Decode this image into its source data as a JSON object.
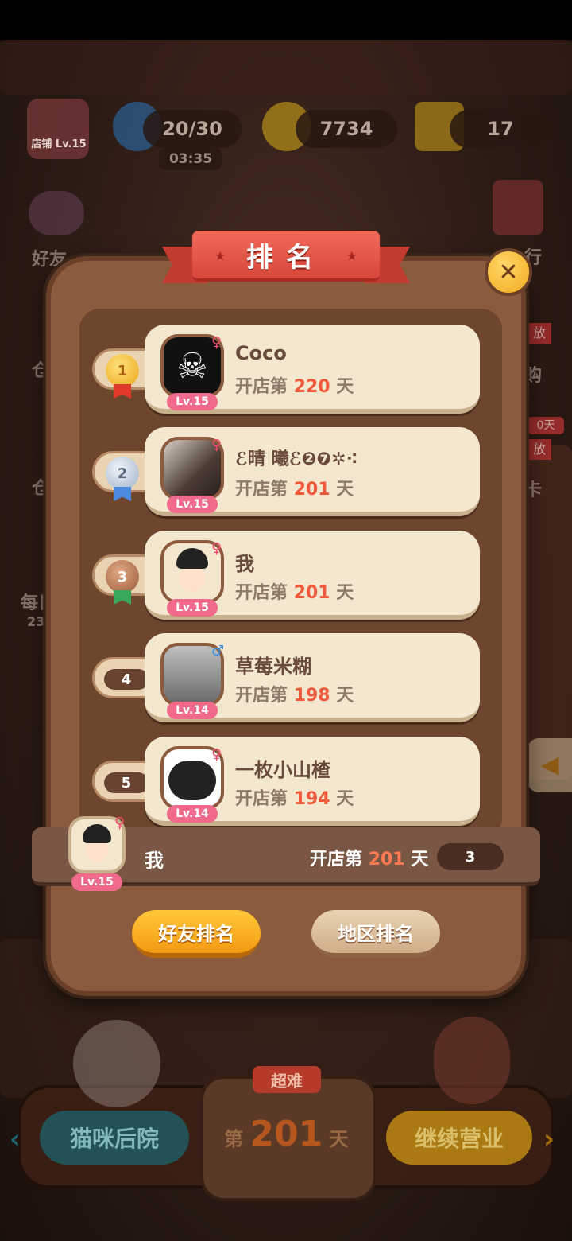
{
  "top": {
    "shop_level": "店铺 Lv.15",
    "energy": "20/30",
    "energy_timer": "03:35",
    "coins": "7734",
    "stars": "17"
  },
  "side": {
    "friends": "好友",
    "left_2": "仓",
    "left_3": "仓",
    "left_4": "每日",
    "left_4_sub": "23",
    "right_1": "行",
    "right_2": "购",
    "right_2_badge": "放",
    "right_3": "卡",
    "right_3_badge": "放",
    "right_3_tag": "0天"
  },
  "modal": {
    "title": "排名",
    "close": "✕",
    "days_prefix": "开店第",
    "days_suffix": "天",
    "players": [
      {
        "rank": "1",
        "name": "Coco",
        "days": "220",
        "level": "Lv.15",
        "gender": "♀"
      },
      {
        "rank": "2",
        "name": "ℰ晴 曦ℰ❷❼✲⁖",
        "days": "201",
        "level": "Lv.15",
        "gender": "♀"
      },
      {
        "rank": "3",
        "name": "我",
        "days": "201",
        "level": "Lv.15",
        "gender": "♀"
      },
      {
        "rank": "4",
        "name": "草莓米糊",
        "days": "198",
        "level": "Lv.14",
        "gender": "♂"
      },
      {
        "rank": "5",
        "name": "一枚小山楂",
        "days": "194",
        "level": "Lv.14",
        "gender": "♀"
      }
    ],
    "me": {
      "name": "我",
      "days": "201",
      "level": "Lv.15",
      "rank": "3",
      "gender": "♀"
    },
    "tabs": {
      "friend": "好友排名",
      "region": "地区排名"
    }
  },
  "bottom": {
    "cat_backyard": "猫咪后院",
    "difficulty": "超难",
    "day_prefix": "第",
    "day_num": "201",
    "day_suffix": "天",
    "continue": "继续营业"
  }
}
